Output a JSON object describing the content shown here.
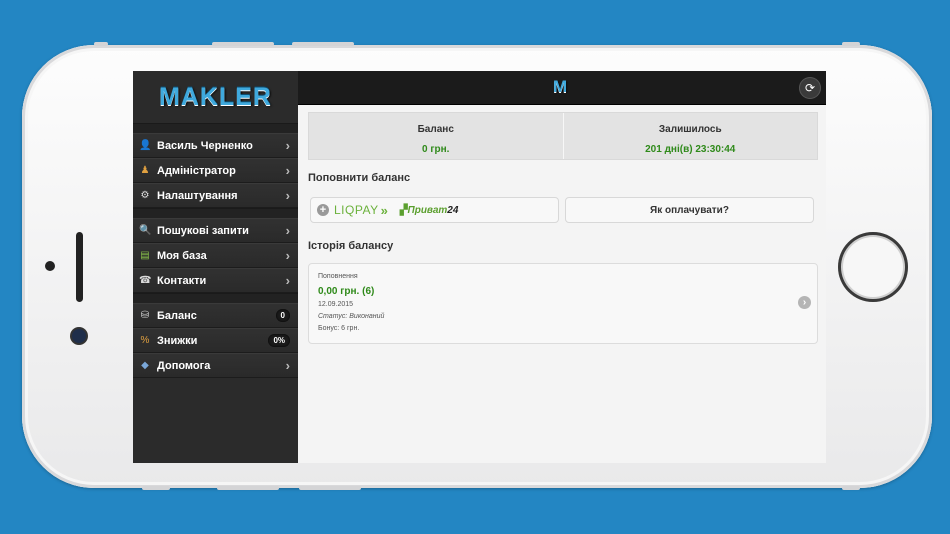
{
  "app": {
    "logo": "MAKLER",
    "top_logo": "M"
  },
  "sidebar": {
    "groups": [
      [
        {
          "label": "Василь Черненко",
          "icon": "user-icon",
          "glyph": "👤",
          "color": "#7aa7d8"
        },
        {
          "label": "Адміністратор",
          "icon": "admin-icon",
          "glyph": "♟",
          "color": "#e0a040"
        },
        {
          "label": "Налаштування",
          "icon": "gear-icon",
          "glyph": "⚙",
          "color": "#dddddd"
        }
      ],
      [
        {
          "label": "Пошукові запити",
          "icon": "search-icon",
          "glyph": "🔍",
          "color": "#7aa7d8"
        },
        {
          "label": "Моя база",
          "icon": "database-icon",
          "glyph": "▤",
          "color": "#8ac24a"
        },
        {
          "label": "Контакти",
          "icon": "phone-icon",
          "glyph": "☎",
          "color": "#dddddd"
        }
      ],
      [
        {
          "label": "Баланс",
          "icon": "money-bag-icon",
          "glyph": "⛁",
          "color": "#dddddd",
          "badge": "0"
        },
        {
          "label": "Знижки",
          "icon": "percent-icon",
          "glyph": "%",
          "color": "#e0a040",
          "badge": "0%"
        },
        {
          "label": "Допомога",
          "icon": "help-icon",
          "glyph": "◆",
          "color": "#7aa7d8"
        }
      ]
    ]
  },
  "stats": {
    "balance_label": "Баланс",
    "balance_value": "0 грн.",
    "remaining_label": "Залишилось",
    "remaining_value": "201 дні(в) 23:30:44"
  },
  "topup": {
    "title": "Поповнити баланс",
    "liqpay_label": "LIQPAY",
    "privat_label": "Приват",
    "privat_num": "24",
    "how_to_pay": "Як оплачувати?"
  },
  "history": {
    "title": "Історія балансу",
    "items": [
      {
        "type": "Поповнення",
        "amount": "0,00 грн. (6)",
        "date": "12.09.2015",
        "status": "Статус: Виконаний",
        "bonus": "Бонус: 6 грн."
      }
    ]
  },
  "colors": {
    "accent": "#3fa9dd",
    "positive": "#2f8a1a",
    "liqpay": "#6cb23d",
    "background": "#2386c3"
  }
}
